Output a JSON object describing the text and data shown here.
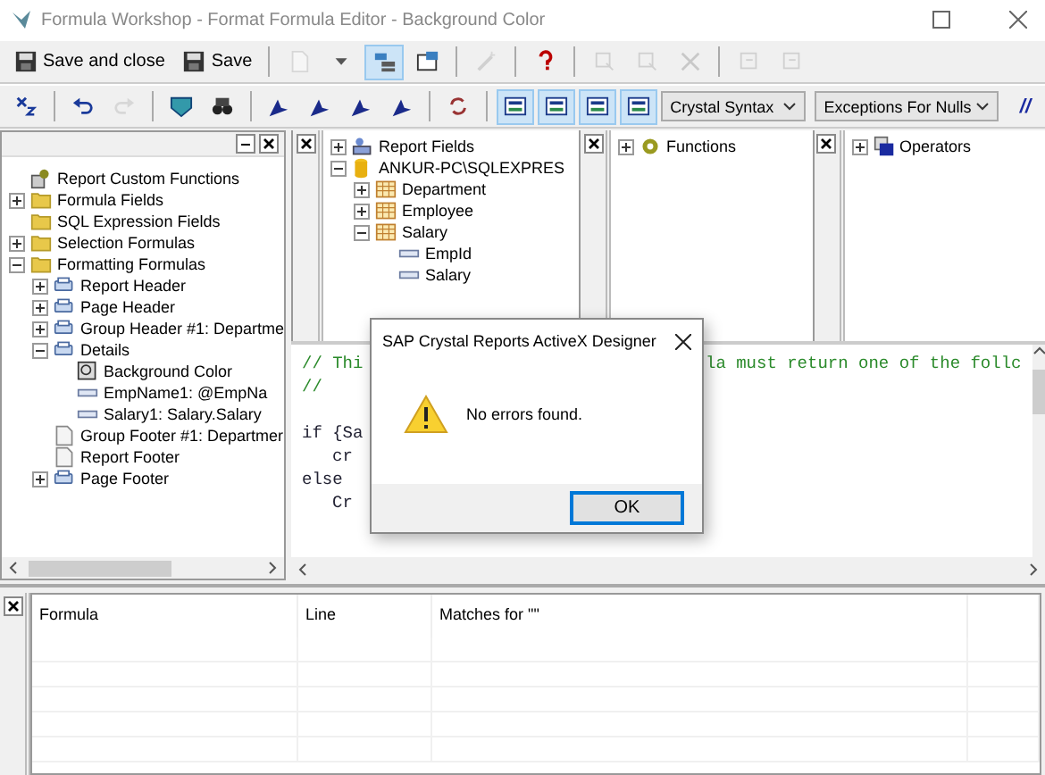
{
  "window": {
    "title": "Formula Workshop - Format Formula Editor - Background Color"
  },
  "toolbar_1": [
    {
      "kind": "button",
      "label": "Save and close"
    },
    {
      "kind": "button",
      "label": "Save"
    },
    {
      "kind": "separator"
    },
    {
      "kind": "icon",
      "disabled": true,
      "pressed": false
    },
    {
      "kind": "icon",
      "disabled": false,
      "pressed": false
    },
    {
      "kind": "icon",
      "disabled": false,
      "pressed": true
    },
    {
      "kind": "icon",
      "disabled": false,
      "pressed": false
    },
    {
      "kind": "separator"
    },
    {
      "kind": "icon",
      "disabled": true,
      "pressed": false
    },
    {
      "kind": "separator"
    },
    {
      "kind": "icon",
      "disabled": false,
      "pressed": false
    },
    {
      "kind": "separator"
    },
    {
      "kind": "icon",
      "disabled": true,
      "pressed": false
    },
    {
      "kind": "icon",
      "disabled": true,
      "pressed": false
    },
    {
      "kind": "icon",
      "disabled": true,
      "pressed": false
    },
    {
      "kind": "separator"
    },
    {
      "kind": "icon",
      "disabled": true,
      "pressed": false
    },
    {
      "kind": "icon",
      "disabled": true,
      "pressed": false
    }
  ],
  "toolbar_2": [
    {
      "kind": "icon",
      "disabled": false,
      "pressed": false
    },
    {
      "kind": "separator"
    },
    {
      "kind": "icon",
      "disabled": false,
      "pressed": false
    },
    {
      "kind": "icon",
      "disabled": true,
      "pressed": false
    },
    {
      "kind": "separator"
    },
    {
      "kind": "icon",
      "disabled": false,
      "pressed": false
    },
    {
      "kind": "icon",
      "disabled": false,
      "pressed": false
    },
    {
      "kind": "separator"
    },
    {
      "kind": "icon",
      "disabled": false,
      "pressed": false
    },
    {
      "kind": "icon",
      "disabled": false,
      "pressed": false
    },
    {
      "kind": "icon",
      "disabled": false,
      "pressed": false
    },
    {
      "kind": "icon",
      "disabled": false,
      "pressed": false
    },
    {
      "kind": "separator"
    },
    {
      "kind": "icon",
      "disabled": false,
      "pressed": false
    },
    {
      "kind": "separator"
    },
    {
      "kind": "icon",
      "disabled": false,
      "pressed": true
    },
    {
      "kind": "icon",
      "disabled": false,
      "pressed": true
    },
    {
      "kind": "icon",
      "disabled": false,
      "pressed": true
    },
    {
      "kind": "icon",
      "disabled": false,
      "pressed": true
    },
    {
      "kind": "select",
      "value": "Crystal Syntax"
    },
    {
      "kind": "select",
      "value": "Exceptions For Nulls"
    },
    {
      "kind": "text",
      "label": "//"
    }
  ],
  "workshop_tree": [
    {
      "label": "Report Custom Functions",
      "kind": "custom"
    },
    {
      "label": "Formula Fields",
      "kind": "folder",
      "expanded": false
    },
    {
      "label": "SQL Expression Fields",
      "kind": "folder"
    },
    {
      "label": "Selection Formulas",
      "kind": "folder",
      "expanded": false
    },
    {
      "label": "Formatting Formulas",
      "kind": "folder",
      "expanded": true,
      "children": [
        {
          "label": "Report Header",
          "kind": "section",
          "expanded": false
        },
        {
          "label": "Page Header",
          "kind": "section",
          "expanded": false
        },
        {
          "label": "Group Header #1: Departme",
          "kind": "section",
          "expanded": false
        },
        {
          "label": "Details",
          "kind": "section",
          "expanded": true,
          "children": [
            {
              "label": "Background Color",
              "kind": "formula"
            },
            {
              "label": "EmpName1: @EmpNa",
              "kind": "field"
            },
            {
              "label": "Salary1: Salary.Salary",
              "kind": "field"
            }
          ]
        },
        {
          "label": "Group Footer #1: Departmer",
          "kind": "page"
        },
        {
          "label": "Report Footer",
          "kind": "page"
        },
        {
          "label": "Page Footer",
          "kind": "section",
          "expanded": false
        }
      ]
    }
  ],
  "field_tree": [
    {
      "label": "Report Fields",
      "kind": "report",
      "expanded": false
    },
    {
      "label": "ANKUR-PC\\SQLEXPRES",
      "kind": "database",
      "expanded": true,
      "children": [
        {
          "label": "Department",
          "kind": "table",
          "expanded": false
        },
        {
          "label": "Employee",
          "kind": "table",
          "expanded": false
        },
        {
          "label": "Salary",
          "kind": "table",
          "expanded": true,
          "children": [
            {
              "label": "EmpId",
              "kind": "field"
            },
            {
              "label": "Salary",
              "kind": "field"
            }
          ]
        }
      ]
    }
  ],
  "function_tree": [
    {
      "label": "Functions",
      "kind": "gear",
      "expanded": false
    }
  ],
  "operator_tree": [
    {
      "label": "Operators",
      "kind": "operator",
      "expanded": false
    }
  ],
  "editor": {
    "lines": [
      {
        "kind": "comment",
        "text": "// Thi",
        "tail": "la must return one of the follc"
      },
      {
        "kind": "comment",
        "text": "//"
      },
      {
        "kind": "blank"
      },
      {
        "kind": "code",
        "text": "if {Sa",
        "indent": false
      },
      {
        "kind": "code",
        "text": "cr",
        "indent": true
      },
      {
        "kind": "code",
        "text": "else",
        "indent": false
      },
      {
        "kind": "code",
        "text": "Cr",
        "indent": true
      }
    ]
  },
  "results": {
    "columns": [
      "Formula",
      "Line",
      "Matches for \"\""
    ]
  },
  "dialog": {
    "title": "SAP Crystal Reports ActiveX Designer",
    "message": "No errors found.",
    "button": "OK"
  }
}
